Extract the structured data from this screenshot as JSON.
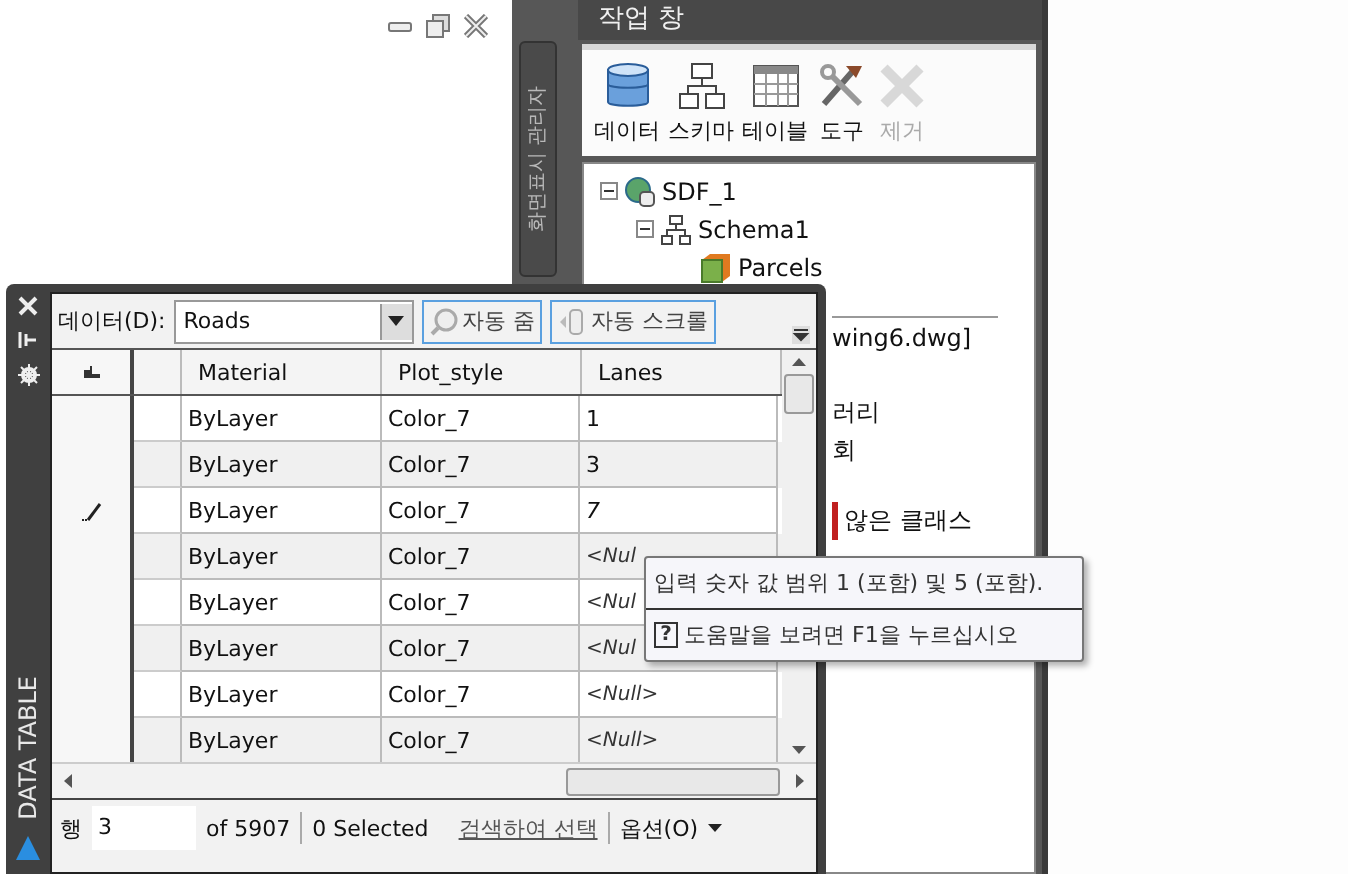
{
  "side_tab": {
    "label": "화면표시 관리자"
  },
  "task_pane": {
    "title": "작업 창",
    "tools": [
      {
        "label": "데이터",
        "kind": "database",
        "disabled": false
      },
      {
        "label": "스키마",
        "kind": "schema",
        "disabled": false
      },
      {
        "label": "테이블",
        "kind": "table",
        "disabled": false
      },
      {
        "label": "도구",
        "kind": "tools",
        "disabled": false
      },
      {
        "label": "제거",
        "kind": "remove",
        "disabled": true
      }
    ],
    "tree": [
      {
        "label": "SDF_1",
        "kind": "datasource",
        "expanded": true,
        "children": [
          {
            "label": "Schema1",
            "kind": "schema",
            "expanded": true,
            "children": [
              {
                "label": "Parcels",
                "kind": "class"
              }
            ]
          }
        ]
      }
    ],
    "covered_lines": [
      {
        "text": "wing6.dwg]",
        "flag": false
      },
      {
        "text": "러리",
        "flag": false
      },
      {
        "text": "회",
        "flag": false
      },
      {
        "text": "않은 클래스",
        "flag": true
      }
    ]
  },
  "data_table": {
    "title": "DATA TABLE",
    "source_label": "데이터(D):",
    "source": "Roads",
    "buttons": [
      {
        "label": "자동 줌",
        "kind": "zoom"
      },
      {
        "label": "자동 스크롤",
        "kind": "scroll"
      }
    ],
    "columns": [
      "Material",
      "Plot_style",
      "Lanes"
    ],
    "rows": [
      {
        "cells": [
          "ByLayer",
          "Color_7",
          "1"
        ],
        "editing": false,
        "null": false
      },
      {
        "cells": [
          "ByLayer",
          "Color_7",
          "3"
        ],
        "editing": false,
        "null": false
      },
      {
        "cells": [
          "ByLayer",
          "Color_7",
          "7"
        ],
        "editing": true,
        "null": false
      },
      {
        "cells": [
          "ByLayer",
          "Color_7",
          "<Nul"
        ],
        "editing": false,
        "null": true
      },
      {
        "cells": [
          "ByLayer",
          "Color_7",
          "<Nul"
        ],
        "editing": false,
        "null": true
      },
      {
        "cells": [
          "ByLayer",
          "Color_7",
          "<Nul"
        ],
        "editing": false,
        "null": true
      },
      {
        "cells": [
          "ByLayer",
          "Color_7",
          "<Null>"
        ],
        "editing": false,
        "null": true
      },
      {
        "cells": [
          "ByLayer",
          "Color_7",
          "<Null>"
        ],
        "editing": false,
        "null": true
      }
    ],
    "status": {
      "row_label": "행",
      "row_value": "3",
      "count": "of 5907",
      "selected": "0 Selected",
      "select_link": "검색하여 선택",
      "options": "옵션(O)"
    }
  },
  "tooltip": {
    "text": "입력 숫자 값 범위 1 (포함) 및 5 (포함).",
    "help_key": "?",
    "help": "도움말을 보려면 F1을 누르십시오"
  }
}
